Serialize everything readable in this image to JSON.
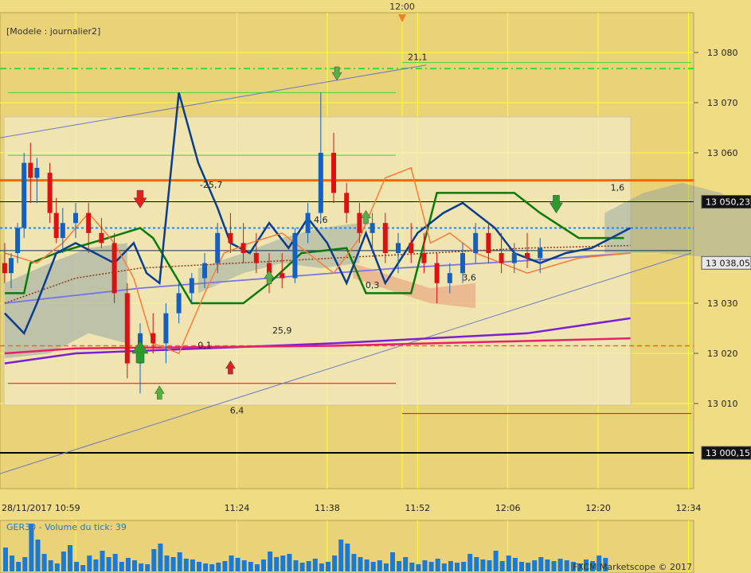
{
  "title": "[Modele : journalier2]",
  "top_time_label": "12:00",
  "footer_brand": "FXCM Marketscope © 2017",
  "volume_label": "GER30 - Volume du tick: 39",
  "colors": {
    "background": "#f0dc82",
    "plot_bg": "#e9d278",
    "volume_bg": "#e9d278",
    "grid": "#ffff00",
    "bull": "#1560bd",
    "bear": "#dd1111",
    "orange_level": "#ff6600",
    "navy_line": "#0b3d8c",
    "green_line": "#0a7a0a"
  },
  "chart_data": {
    "type": "line",
    "instrument": "GER30",
    "ylim": [
      12985,
      13090
    ],
    "y_ticks": [
      {
        "value": 13080,
        "label": "13 080"
      },
      {
        "value": 13070,
        "label": "13 070"
      },
      {
        "value": 13060,
        "label": "13 060"
      },
      {
        "value": 13030,
        "label": "13 030"
      },
      {
        "value": 13020,
        "label": "13 020"
      },
      {
        "value": 13010,
        "label": "13 010"
      }
    ],
    "price_boxes": [
      {
        "value": 13050.23,
        "label": "13 050,23",
        "style": "dark"
      },
      {
        "value": 13038.05,
        "label": "13 038,05",
        "style": "light"
      },
      {
        "value": 13000.15,
        "label": "13 000,15",
        "style": "dark"
      }
    ],
    "x_ticks": [
      "28/11/2017 10:59",
      "11:24",
      "11:38",
      "11:52",
      "12:06",
      "12:20",
      "12:34"
    ],
    "horizontal_levels": [
      {
        "value": 13076.8,
        "color": "#33dd33",
        "dash": "8,4,2,4",
        "width": 2
      },
      {
        "value": 13054.5,
        "color": "#ff6600",
        "dash": "",
        "width": 3
      },
      {
        "value": 13050.23,
        "color": "#000000",
        "dash": "",
        "width": 1
      },
      {
        "value": 13045,
        "color": "#1a8cff",
        "dash": "3,3",
        "width": 2
      },
      {
        "value": 13000.15,
        "color": "#000000",
        "dash": "",
        "width": 2
      },
      {
        "value": 13021.5,
        "color": "#ff6600",
        "dash": "6,4",
        "width": 1.5
      }
    ],
    "annotations": [
      {
        "text": "21,1",
        "x": "11:52",
        "price": 13078.5
      },
      {
        "text": "-25,7",
        "x": "11:20",
        "price": 13053
      },
      {
        "text": "1,6",
        "x": "12:23",
        "price": 13052.5
      },
      {
        "text": "4,6",
        "x": "11:37",
        "price": 13046
      },
      {
        "text": "0,3",
        "x": "11:45",
        "price": 13033
      },
      {
        "text": "3,6",
        "x": "12:00",
        "price": 13034.5
      },
      {
        "text": "25,9",
        "x": "11:31",
        "price": 13024
      },
      {
        "text": "0,1",
        "x": "11:19",
        "price": 13021
      },
      {
        "text": "6,4",
        "x": "11:24",
        "price": 13008
      }
    ],
    "volume": [
      30,
      20,
      12,
      18,
      60,
      40,
      22,
      14,
      10,
      25,
      33,
      12,
      8,
      20,
      15,
      26,
      18,
      22,
      12,
      17,
      14,
      10,
      9,
      28,
      35,
      20,
      18,
      24,
      16,
      15,
      12,
      10,
      9,
      11,
      13,
      20,
      17,
      14,
      12,
      9,
      15,
      25,
      18,
      20,
      22,
      14,
      11,
      13,
      16,
      10,
      12,
      20,
      40,
      35,
      22,
      18,
      15,
      12,
      14,
      10,
      24,
      13,
      18,
      11,
      9,
      14,
      12,
      16,
      10,
      13,
      11,
      12,
      22,
      18,
      15,
      14,
      26,
      13,
      20,
      17,
      12,
      11,
      14,
      18,
      15,
      13,
      16,
      14,
      12,
      10,
      15,
      13,
      20,
      17
    ]
  }
}
